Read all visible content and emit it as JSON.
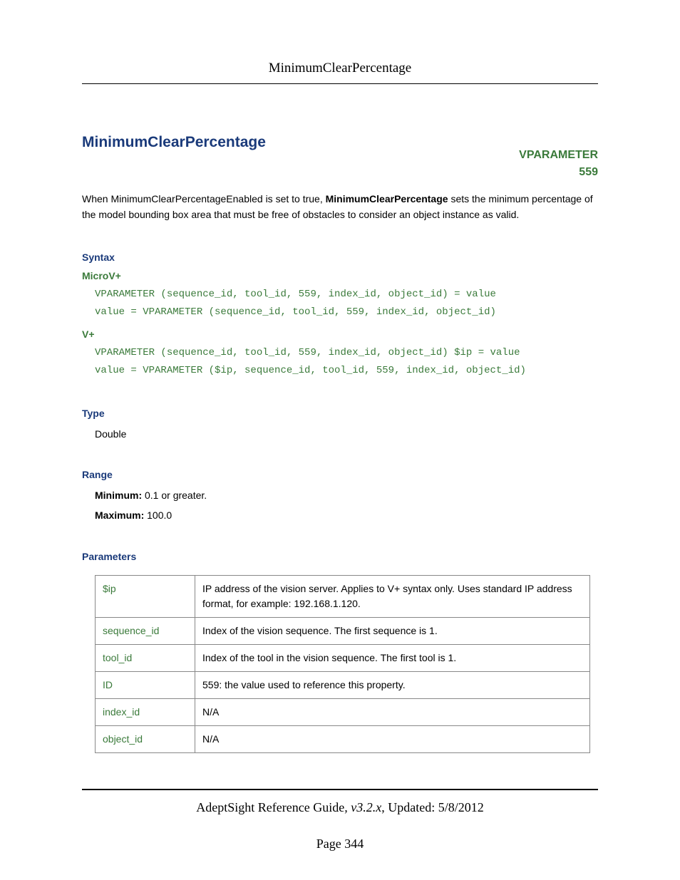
{
  "header": {
    "title": "MinimumClearPercentage"
  },
  "main": {
    "title": "MinimumClearPercentage",
    "vparam_label_line1": "VPARAMETER",
    "vparam_label_line2": "559",
    "intro_prefix": "When MinimumClearPercentageEnabled is set to true, ",
    "intro_bold": "MinimumClearPercentage",
    "intro_suffix": " sets the minimum percentage of the model bounding box area that must be free of obstacles to consider an object instance as valid.",
    "syntax": {
      "heading": "Syntax",
      "microv": {
        "label": "MicroV+",
        "line1": "VPARAMETER (sequence_id, tool_id, 559, index_id, object_id) = value",
        "line2": "value = VPARAMETER (sequence_id, tool_id, 559, index_id, object_id)"
      },
      "vplus": {
        "label": "V+",
        "line1": "VPARAMETER (sequence_id, tool_id, 559, index_id, object_id) $ip = value",
        "line2": "value = VPARAMETER ($ip, sequence_id, tool_id, 559, index_id, object_id)"
      }
    },
    "type": {
      "heading": "Type",
      "value": "Double"
    },
    "range": {
      "heading": "Range",
      "min_label": "Minimum:",
      "min_value": " 0.1 or greater.",
      "max_label": "Maximum:",
      "max_value": " 100.0"
    },
    "parameters": {
      "heading": "Parameters",
      "rows": [
        {
          "name": "$ip",
          "desc": "IP address of the vision server. Applies to V+ syntax only. Uses standard IP address format, for example: 192.168.1.120."
        },
        {
          "name": "sequence_id",
          "desc": "Index of the vision sequence. The first sequence is 1."
        },
        {
          "name": "tool_id",
          "desc": "Index of the tool in the vision sequence. The first tool is 1."
        },
        {
          "name": "ID",
          "desc": "559: the value used to reference this property."
        },
        {
          "name": "index_id",
          "desc": "N/A"
        },
        {
          "name": "object_id",
          "desc": "N/A"
        }
      ]
    }
  },
  "footer": {
    "guide": "AdeptSight Reference Guide",
    "version": ", v3.2.x",
    "updated": ", Updated: 5/8/2012",
    "page": "Page 344"
  }
}
